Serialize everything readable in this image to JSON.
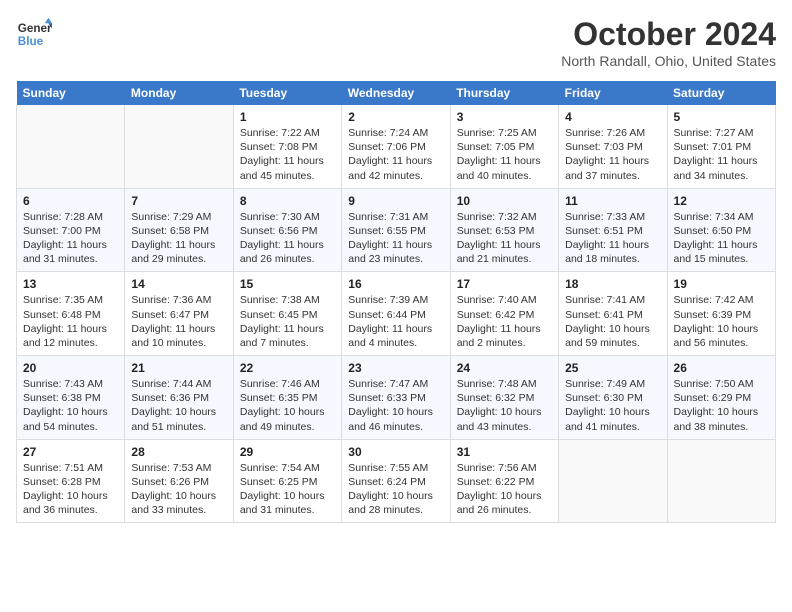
{
  "header": {
    "logo_line1": "General",
    "logo_line2": "Blue",
    "month": "October 2024",
    "location": "North Randall, Ohio, United States"
  },
  "days_of_week": [
    "Sunday",
    "Monday",
    "Tuesday",
    "Wednesday",
    "Thursday",
    "Friday",
    "Saturday"
  ],
  "weeks": [
    [
      {
        "day": "",
        "empty": true
      },
      {
        "day": "",
        "empty": true
      },
      {
        "day": "1",
        "sunrise": "7:22 AM",
        "sunset": "7:08 PM",
        "daylight": "11 hours and 45 minutes."
      },
      {
        "day": "2",
        "sunrise": "7:24 AM",
        "sunset": "7:06 PM",
        "daylight": "11 hours and 42 minutes."
      },
      {
        "day": "3",
        "sunrise": "7:25 AM",
        "sunset": "7:05 PM",
        "daylight": "11 hours and 40 minutes."
      },
      {
        "day": "4",
        "sunrise": "7:26 AM",
        "sunset": "7:03 PM",
        "daylight": "11 hours and 37 minutes."
      },
      {
        "day": "5",
        "sunrise": "7:27 AM",
        "sunset": "7:01 PM",
        "daylight": "11 hours and 34 minutes."
      }
    ],
    [
      {
        "day": "6",
        "sunrise": "7:28 AM",
        "sunset": "7:00 PM",
        "daylight": "11 hours and 31 minutes."
      },
      {
        "day": "7",
        "sunrise": "7:29 AM",
        "sunset": "6:58 PM",
        "daylight": "11 hours and 29 minutes."
      },
      {
        "day": "8",
        "sunrise": "7:30 AM",
        "sunset": "6:56 PM",
        "daylight": "11 hours and 26 minutes."
      },
      {
        "day": "9",
        "sunrise": "7:31 AM",
        "sunset": "6:55 PM",
        "daylight": "11 hours and 23 minutes."
      },
      {
        "day": "10",
        "sunrise": "7:32 AM",
        "sunset": "6:53 PM",
        "daylight": "11 hours and 21 minutes."
      },
      {
        "day": "11",
        "sunrise": "7:33 AM",
        "sunset": "6:51 PM",
        "daylight": "11 hours and 18 minutes."
      },
      {
        "day": "12",
        "sunrise": "7:34 AM",
        "sunset": "6:50 PM",
        "daylight": "11 hours and 15 minutes."
      }
    ],
    [
      {
        "day": "13",
        "sunrise": "7:35 AM",
        "sunset": "6:48 PM",
        "daylight": "11 hours and 12 minutes."
      },
      {
        "day": "14",
        "sunrise": "7:36 AM",
        "sunset": "6:47 PM",
        "daylight": "11 hours and 10 minutes."
      },
      {
        "day": "15",
        "sunrise": "7:38 AM",
        "sunset": "6:45 PM",
        "daylight": "11 hours and 7 minutes."
      },
      {
        "day": "16",
        "sunrise": "7:39 AM",
        "sunset": "6:44 PM",
        "daylight": "11 hours and 4 minutes."
      },
      {
        "day": "17",
        "sunrise": "7:40 AM",
        "sunset": "6:42 PM",
        "daylight": "11 hours and 2 minutes."
      },
      {
        "day": "18",
        "sunrise": "7:41 AM",
        "sunset": "6:41 PM",
        "daylight": "10 hours and 59 minutes."
      },
      {
        "day": "19",
        "sunrise": "7:42 AM",
        "sunset": "6:39 PM",
        "daylight": "10 hours and 56 minutes."
      }
    ],
    [
      {
        "day": "20",
        "sunrise": "7:43 AM",
        "sunset": "6:38 PM",
        "daylight": "10 hours and 54 minutes."
      },
      {
        "day": "21",
        "sunrise": "7:44 AM",
        "sunset": "6:36 PM",
        "daylight": "10 hours and 51 minutes."
      },
      {
        "day": "22",
        "sunrise": "7:46 AM",
        "sunset": "6:35 PM",
        "daylight": "10 hours and 49 minutes."
      },
      {
        "day": "23",
        "sunrise": "7:47 AM",
        "sunset": "6:33 PM",
        "daylight": "10 hours and 46 minutes."
      },
      {
        "day": "24",
        "sunrise": "7:48 AM",
        "sunset": "6:32 PM",
        "daylight": "10 hours and 43 minutes."
      },
      {
        "day": "25",
        "sunrise": "7:49 AM",
        "sunset": "6:30 PM",
        "daylight": "10 hours and 41 minutes."
      },
      {
        "day": "26",
        "sunrise": "7:50 AM",
        "sunset": "6:29 PM",
        "daylight": "10 hours and 38 minutes."
      }
    ],
    [
      {
        "day": "27",
        "sunrise": "7:51 AM",
        "sunset": "6:28 PM",
        "daylight": "10 hours and 36 minutes."
      },
      {
        "day": "28",
        "sunrise": "7:53 AM",
        "sunset": "6:26 PM",
        "daylight": "10 hours and 33 minutes."
      },
      {
        "day": "29",
        "sunrise": "7:54 AM",
        "sunset": "6:25 PM",
        "daylight": "10 hours and 31 minutes."
      },
      {
        "day": "30",
        "sunrise": "7:55 AM",
        "sunset": "6:24 PM",
        "daylight": "10 hours and 28 minutes."
      },
      {
        "day": "31",
        "sunrise": "7:56 AM",
        "sunset": "6:22 PM",
        "daylight": "10 hours and 26 minutes."
      },
      {
        "day": "",
        "empty": true
      },
      {
        "day": "",
        "empty": true
      }
    ]
  ]
}
